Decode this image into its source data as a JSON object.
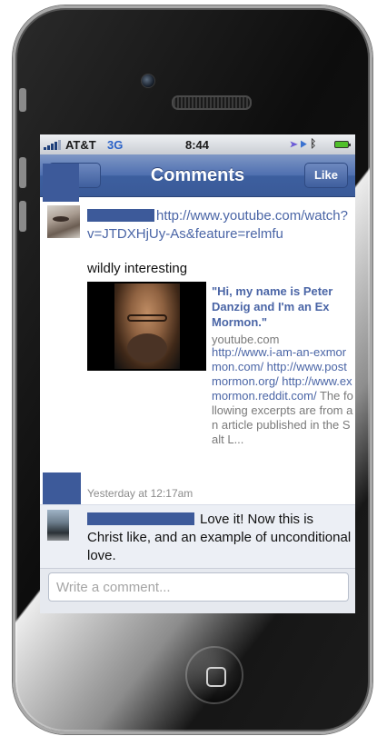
{
  "status_bar": {
    "carrier": "AT&T",
    "network": "3G",
    "time": "8:44"
  },
  "nav": {
    "title": "Comments",
    "like_label": "Like"
  },
  "comments": [
    {
      "author": "",
      "link_text": "http://www.youtube.com/watch?v=JTDXHjUy-As&feature=relmfu",
      "text": "wildly interesting",
      "preview": {
        "title": "\"Hi, my name is Peter Danzig and I'm an Ex Mormon.\"",
        "domain": "youtube.com",
        "desc_links": "http://www.i-am-an-exmormon.com/ http://www.postmormon.org/ http://www.exmormon.reddit.com/",
        "desc_rest": " The following excerpts are from an article published in the Salt L..."
      },
      "time": "Yesterday at 12:17am"
    },
    {
      "author": "",
      "text": "Love it! Now this is Christ like, and an example of unconditional love."
    }
  ],
  "composer": {
    "placeholder": "Write a comment..."
  },
  "colors": {
    "facebook_blue": "#3d5a9a",
    "link_blue": "#4a65a6"
  }
}
